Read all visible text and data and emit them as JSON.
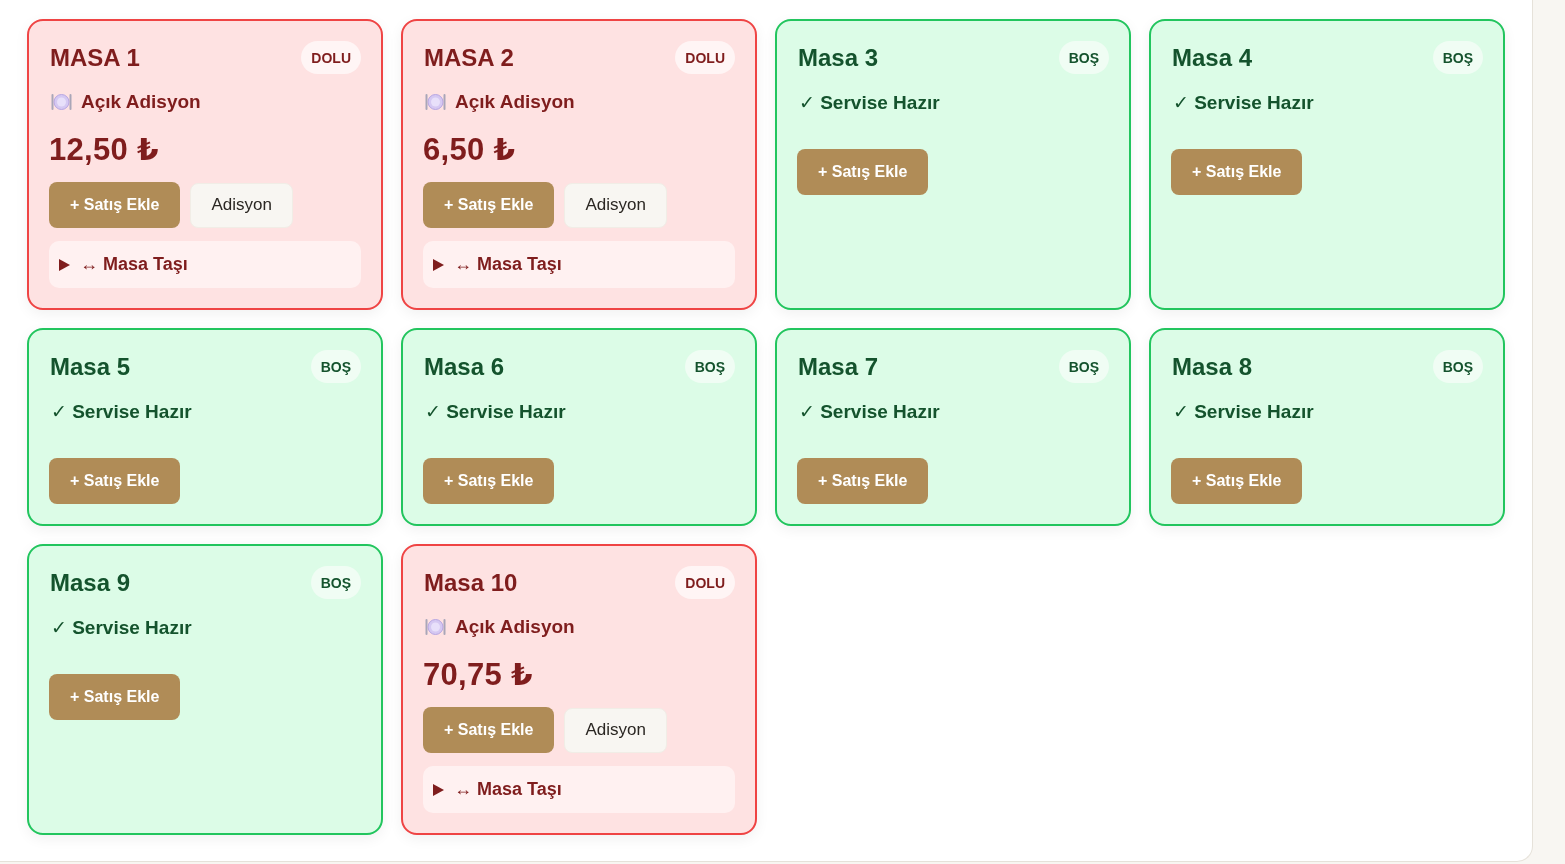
{
  "tables": [
    {
      "name": "MASA 1",
      "kind": "occupied",
      "badge": "DOLU",
      "status": "Açık Adisyon",
      "total": "12,50 ₺",
      "add_button": "+ Satış Ekle",
      "bill_button": "Adisyon",
      "move": {
        "label": "↔ Masa Taşı",
        "expanded": false
      }
    },
    {
      "name": "MASA 2",
      "kind": "occupied",
      "badge": "DOLU",
      "status": "Açık Adisyon",
      "total": "6,50 ₺",
      "add_button": "+ Satış Ekle",
      "bill_button": "Adisyon",
      "move": {
        "label": "↔ Masa Taşı",
        "expanded": false
      }
    },
    {
      "name": "Masa 3",
      "kind": "empty",
      "badge": "BOŞ",
      "status": "✓ Servise Hazır",
      "add_button": "+ Satış Ekle"
    },
    {
      "name": "Masa 4",
      "kind": "empty",
      "badge": "BOŞ",
      "status": "✓ Servise Hazır",
      "add_button": "+ Satış Ekle"
    },
    {
      "name": "Masa 5",
      "kind": "empty",
      "badge": "BOŞ",
      "status": "✓ Servise Hazır",
      "add_button": "+ Satış Ekle"
    },
    {
      "name": "Masa 6",
      "kind": "empty",
      "badge": "BOŞ",
      "status": "✓ Servise Hazır",
      "add_button": "+ Satış Ekle"
    },
    {
      "name": "Masa 7",
      "kind": "empty",
      "badge": "BOŞ",
      "status": "✓ Servise Hazır",
      "add_button": "+ Satış Ekle"
    },
    {
      "name": "Masa 8",
      "kind": "empty",
      "badge": "BOŞ",
      "status": "✓ Servise Hazır",
      "add_button": "+ Satış Ekle"
    },
    {
      "name": "Masa 9",
      "kind": "empty",
      "badge": "BOŞ",
      "status": "✓ Servise Hazır",
      "add_button": "+ Satış Ekle"
    },
    {
      "name": "Masa 10",
      "kind": "occupied",
      "badge": "DOLU",
      "status": "Açık Adisyon",
      "total": "70,75 ₺",
      "add_button": "+ Satış Ekle",
      "bill_button": "Adisyon",
      "move": {
        "label": "↔ Masa Taşı",
        "expanded": false
      }
    }
  ]
}
